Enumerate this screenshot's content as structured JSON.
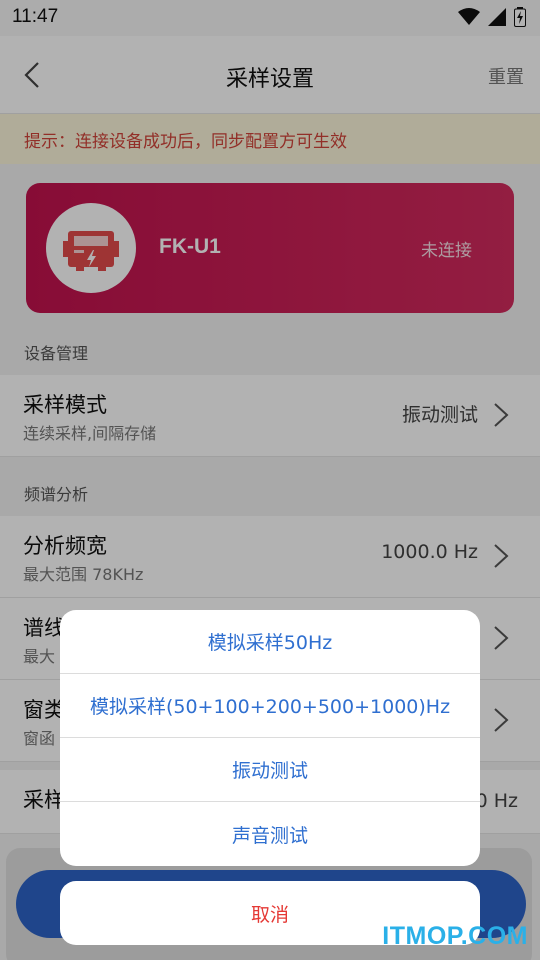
{
  "status_bar": {
    "time": "11:47"
  },
  "nav": {
    "title": "采样设置",
    "reset_label": "重置"
  },
  "tip": "提示：连接设备成功后，同步配置方可生效",
  "device": {
    "name": "FK-U1",
    "status": "未连接",
    "card_color": "#c2124e"
  },
  "sections": {
    "device_management": "设备管理",
    "spectrum_analysis": "频谱分析"
  },
  "rows": [
    {
      "title": "采样模式",
      "subtitle": "连续采样,间隔存储",
      "value": "振动测试"
    },
    {
      "title": "分析频宽",
      "subtitle": "最大范围 78KHz",
      "value": "1000.0 Hz"
    },
    {
      "title": "谱线",
      "subtitle": "最大",
      "value": ""
    },
    {
      "title": "窗类",
      "subtitle": "窗函",
      "value": ""
    },
    {
      "title": "采样",
      "subtitle": "",
      "value": "0 Hz"
    }
  ],
  "action_sheet": {
    "options": [
      "模拟采样50Hz",
      "模拟采样(50+100+200+500+1000)Hz",
      "振动测试",
      "声音测试"
    ],
    "cancel_label": "取消"
  },
  "watermark": "ITMOP.COM",
  "colors": {
    "accent_blue": "#2f6fd0",
    "cancel_red": "#e53935",
    "tip_red": "#d1443a"
  }
}
